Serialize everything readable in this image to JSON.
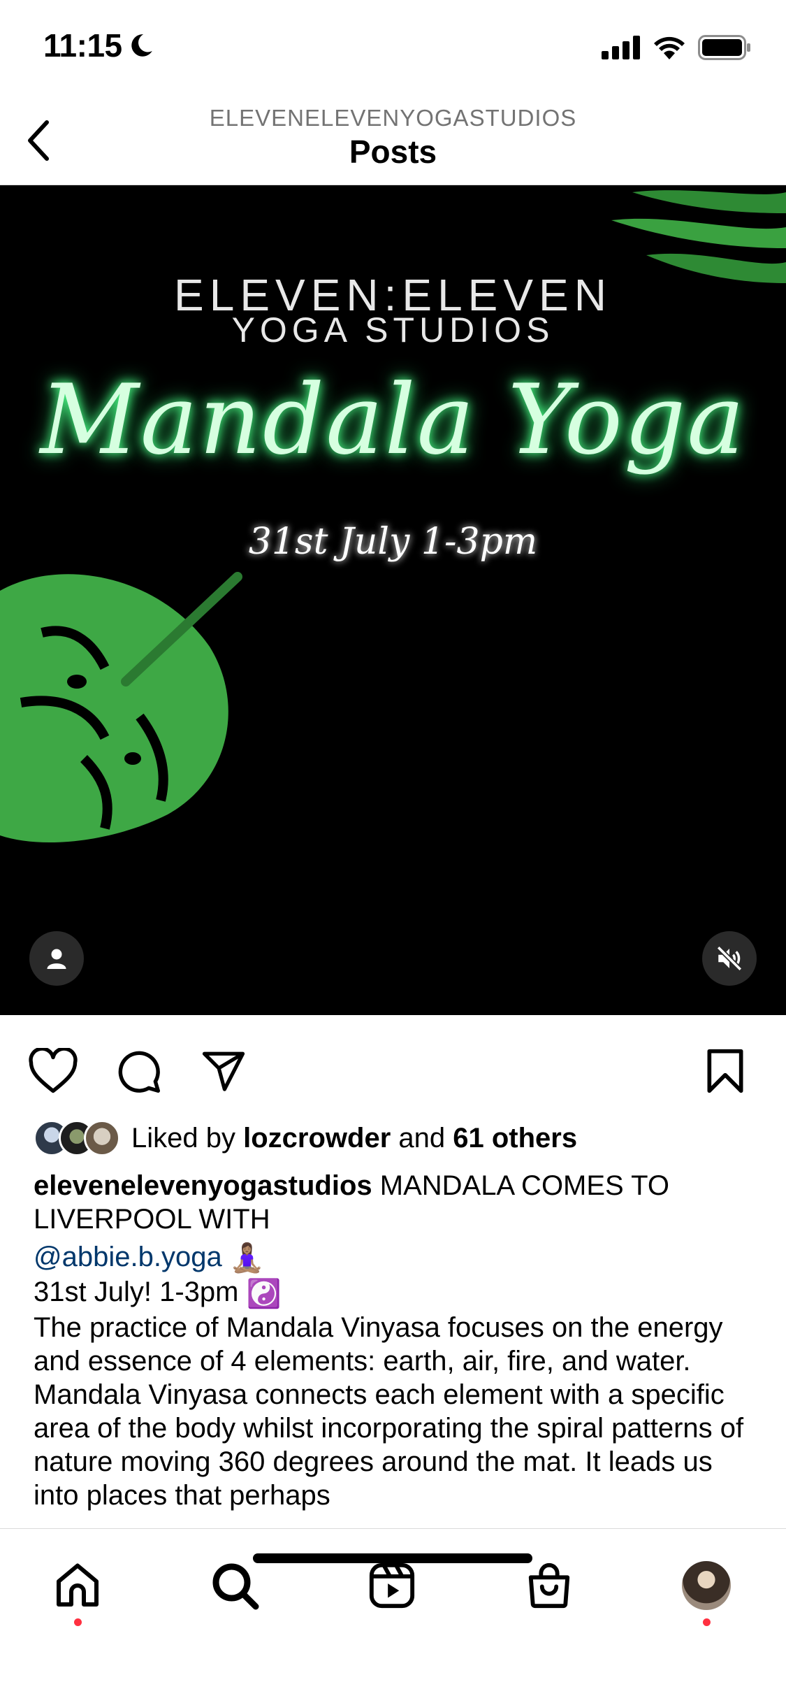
{
  "status": {
    "time": "11:15"
  },
  "header": {
    "subtitle": "ELEVENELEVENYOGASTUDIOS",
    "title": "Posts"
  },
  "media": {
    "brand_line1": "ELEVEN:ELEVEN",
    "brand_line2": "YOGA STUDIOS",
    "event_title": "Mandala Yoga",
    "event_date": "31st July 1-3pm",
    "background": "#000000",
    "glow_color": "#4cff89"
  },
  "likes": {
    "prefix": "Liked by ",
    "user": "lozcrowder",
    "middle": " and ",
    "count": "61 others"
  },
  "caption": {
    "username": "elevenelevenyogastudios",
    "line1": " MANDALA COMES TO LIVERPOOL WITH",
    "mention": "@abbie.b.yoga",
    "mention_emoji": "🧘🏽‍♀️",
    "line3": "31st July! 1-3pm",
    "line3_emoji": "☯️",
    "body": "The practice of Mandala Vinyasa focuses on the energy and essence of 4 elements: earth, air, fire, and water. Mandala Vinyasa connects each element with a specific area of the body whilst incorporating the spiral patterns of nature moving 360 degrees around the mat. It leads us into places that perhaps"
  },
  "icons": {
    "back": "chevron-left-icon",
    "like": "heart-icon",
    "comment": "comment-icon",
    "share": "send-icon",
    "save": "bookmark-icon",
    "home": "home-icon",
    "search": "search-icon",
    "reels": "reels-icon",
    "shop": "shop-icon"
  },
  "colors": {
    "mention": "#00376b",
    "notification_dot": "#ff3040",
    "secondary_text": "#737373"
  }
}
